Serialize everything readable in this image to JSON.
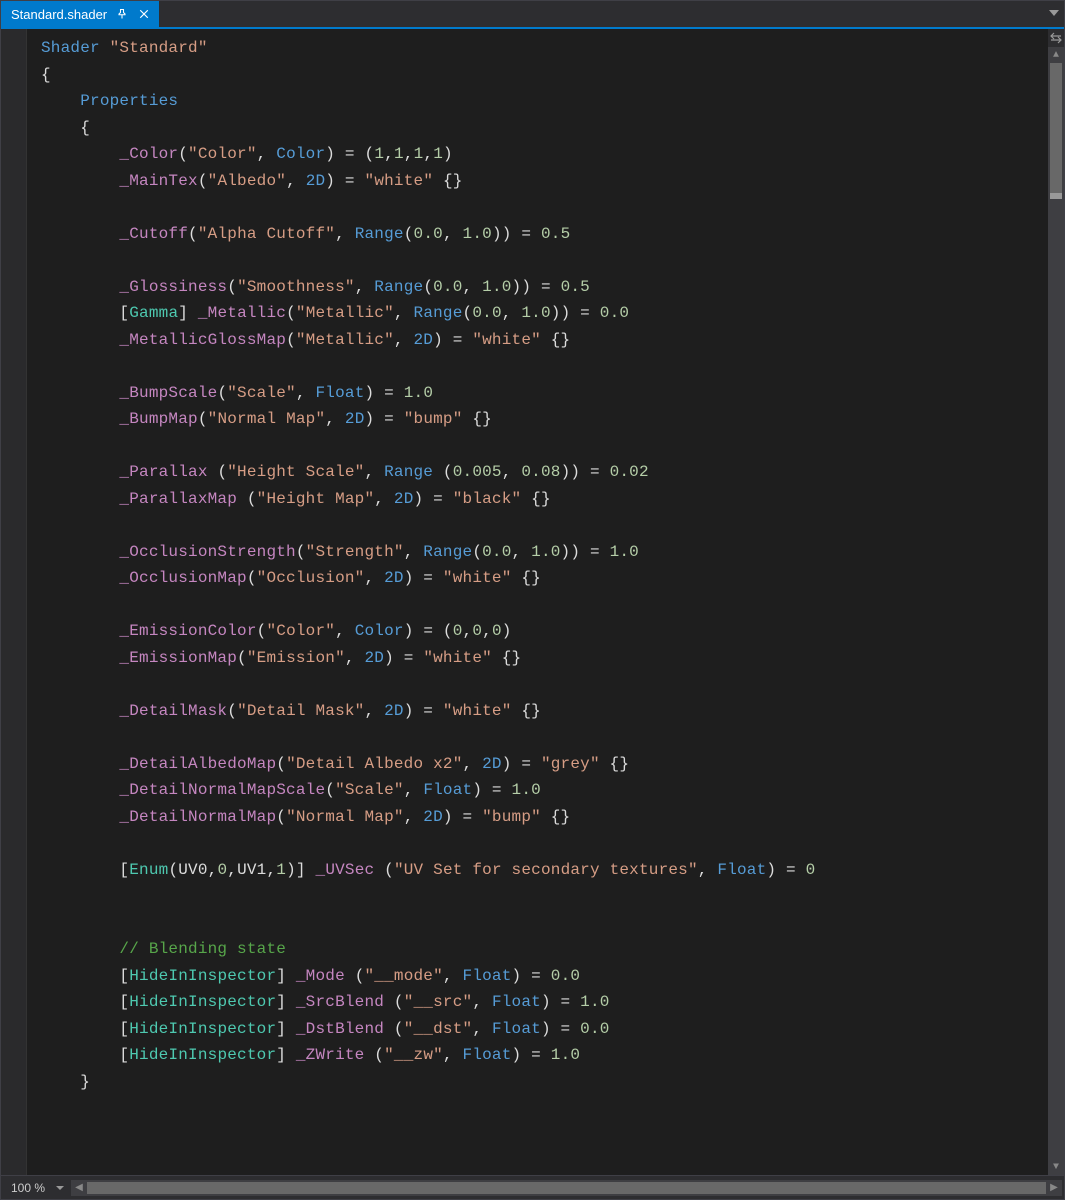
{
  "tab": {
    "title": "Standard.shader"
  },
  "zoom": {
    "value": "100 %"
  },
  "code": {
    "comment_blending": "// Blending state",
    "lines": [
      [
        [
          0,
          "kw",
          "Shader"
        ],
        [
          0,
          "plain",
          " "
        ],
        [
          0,
          "str",
          "\"Standard\""
        ]
      ],
      [
        [
          0,
          "plain",
          "{"
        ]
      ],
      [
        [
          1,
          "kw",
          "Properties"
        ]
      ],
      [
        [
          1,
          "plain",
          "{"
        ]
      ],
      [
        [
          2,
          "id",
          "_Color"
        ],
        [
          0,
          "paren",
          "("
        ],
        [
          0,
          "str",
          "\"Color\""
        ],
        [
          0,
          "paren",
          ", "
        ],
        [
          0,
          "type",
          "Color"
        ],
        [
          0,
          "paren",
          ") = ("
        ],
        [
          0,
          "num",
          "1"
        ],
        [
          0,
          "paren",
          ","
        ],
        [
          0,
          "num",
          "1"
        ],
        [
          0,
          "paren",
          ","
        ],
        [
          0,
          "num",
          "1"
        ],
        [
          0,
          "paren",
          ","
        ],
        [
          0,
          "num",
          "1"
        ],
        [
          0,
          "paren",
          ")"
        ]
      ],
      [
        [
          2,
          "id",
          "_MainTex"
        ],
        [
          0,
          "paren",
          "("
        ],
        [
          0,
          "str",
          "\"Albedo\""
        ],
        [
          0,
          "paren",
          ", "
        ],
        [
          0,
          "type",
          "2D"
        ],
        [
          0,
          "paren",
          ") = "
        ],
        [
          0,
          "str",
          "\"white\""
        ],
        [
          0,
          "paren",
          " {}"
        ]
      ],
      [],
      [
        [
          2,
          "id",
          "_Cutoff"
        ],
        [
          0,
          "paren",
          "("
        ],
        [
          0,
          "str",
          "\"Alpha Cutoff\""
        ],
        [
          0,
          "paren",
          ", "
        ],
        [
          0,
          "type",
          "Range"
        ],
        [
          0,
          "paren",
          "("
        ],
        [
          0,
          "num",
          "0.0"
        ],
        [
          0,
          "paren",
          ", "
        ],
        [
          0,
          "num",
          "1.0"
        ],
        [
          0,
          "paren",
          ")) = "
        ],
        [
          0,
          "num",
          "0.5"
        ]
      ],
      [],
      [
        [
          2,
          "id",
          "_Glossiness"
        ],
        [
          0,
          "paren",
          "("
        ],
        [
          0,
          "str",
          "\"Smoothness\""
        ],
        [
          0,
          "paren",
          ", "
        ],
        [
          0,
          "type",
          "Range"
        ],
        [
          0,
          "paren",
          "("
        ],
        [
          0,
          "num",
          "0.0"
        ],
        [
          0,
          "paren",
          ", "
        ],
        [
          0,
          "num",
          "1.0"
        ],
        [
          0,
          "paren",
          ")) = "
        ],
        [
          0,
          "num",
          "0.5"
        ]
      ],
      [
        [
          2,
          "paren",
          "["
        ],
        [
          0,
          "attr",
          "Gamma"
        ],
        [
          0,
          "paren",
          "] "
        ],
        [
          0,
          "id",
          "_Metallic"
        ],
        [
          0,
          "paren",
          "("
        ],
        [
          0,
          "str",
          "\"Metallic\""
        ],
        [
          0,
          "paren",
          ", "
        ],
        [
          0,
          "type",
          "Range"
        ],
        [
          0,
          "paren",
          "("
        ],
        [
          0,
          "num",
          "0.0"
        ],
        [
          0,
          "paren",
          ", "
        ],
        [
          0,
          "num",
          "1.0"
        ],
        [
          0,
          "paren",
          ")) = "
        ],
        [
          0,
          "num",
          "0.0"
        ]
      ],
      [
        [
          2,
          "id",
          "_MetallicGlossMap"
        ],
        [
          0,
          "paren",
          "("
        ],
        [
          0,
          "str",
          "\"Metallic\""
        ],
        [
          0,
          "paren",
          ", "
        ],
        [
          0,
          "type",
          "2D"
        ],
        [
          0,
          "paren",
          ") = "
        ],
        [
          0,
          "str",
          "\"white\""
        ],
        [
          0,
          "paren",
          " {}"
        ]
      ],
      [],
      [
        [
          2,
          "id",
          "_BumpScale"
        ],
        [
          0,
          "paren",
          "("
        ],
        [
          0,
          "str",
          "\"Scale\""
        ],
        [
          0,
          "paren",
          ", "
        ],
        [
          0,
          "type",
          "Float"
        ],
        [
          0,
          "paren",
          ") = "
        ],
        [
          0,
          "num",
          "1.0"
        ]
      ],
      [
        [
          2,
          "id",
          "_BumpMap"
        ],
        [
          0,
          "paren",
          "("
        ],
        [
          0,
          "str",
          "\"Normal Map\""
        ],
        [
          0,
          "paren",
          ", "
        ],
        [
          0,
          "type",
          "2D"
        ],
        [
          0,
          "paren",
          ") = "
        ],
        [
          0,
          "str",
          "\"bump\""
        ],
        [
          0,
          "paren",
          " {}"
        ]
      ],
      [],
      [
        [
          2,
          "id",
          "_Parallax"
        ],
        [
          0,
          "paren",
          " ("
        ],
        [
          0,
          "str",
          "\"Height Scale\""
        ],
        [
          0,
          "paren",
          ", "
        ],
        [
          0,
          "type",
          "Range"
        ],
        [
          0,
          "paren",
          " ("
        ],
        [
          0,
          "num",
          "0.005"
        ],
        [
          0,
          "paren",
          ", "
        ],
        [
          0,
          "num",
          "0.08"
        ],
        [
          0,
          "paren",
          ")) = "
        ],
        [
          0,
          "num",
          "0.02"
        ]
      ],
      [
        [
          2,
          "id",
          "_ParallaxMap"
        ],
        [
          0,
          "paren",
          " ("
        ],
        [
          0,
          "str",
          "\"Height Map\""
        ],
        [
          0,
          "paren",
          ", "
        ],
        [
          0,
          "type",
          "2D"
        ],
        [
          0,
          "paren",
          ") = "
        ],
        [
          0,
          "str",
          "\"black\""
        ],
        [
          0,
          "paren",
          " {}"
        ]
      ],
      [],
      [
        [
          2,
          "id",
          "_OcclusionStrength"
        ],
        [
          0,
          "paren",
          "("
        ],
        [
          0,
          "str",
          "\"Strength\""
        ],
        [
          0,
          "paren",
          ", "
        ],
        [
          0,
          "type",
          "Range"
        ],
        [
          0,
          "paren",
          "("
        ],
        [
          0,
          "num",
          "0.0"
        ],
        [
          0,
          "paren",
          ", "
        ],
        [
          0,
          "num",
          "1.0"
        ],
        [
          0,
          "paren",
          ")) = "
        ],
        [
          0,
          "num",
          "1.0"
        ]
      ],
      [
        [
          2,
          "id",
          "_OcclusionMap"
        ],
        [
          0,
          "paren",
          "("
        ],
        [
          0,
          "str",
          "\"Occlusion\""
        ],
        [
          0,
          "paren",
          ", "
        ],
        [
          0,
          "type",
          "2D"
        ],
        [
          0,
          "paren",
          ") = "
        ],
        [
          0,
          "str",
          "\"white\""
        ],
        [
          0,
          "paren",
          " {}"
        ]
      ],
      [],
      [
        [
          2,
          "id",
          "_EmissionColor"
        ],
        [
          0,
          "paren",
          "("
        ],
        [
          0,
          "str",
          "\"Color\""
        ],
        [
          0,
          "paren",
          ", "
        ],
        [
          0,
          "type",
          "Color"
        ],
        [
          0,
          "paren",
          ") = ("
        ],
        [
          0,
          "num",
          "0"
        ],
        [
          0,
          "paren",
          ","
        ],
        [
          0,
          "num",
          "0"
        ],
        [
          0,
          "paren",
          ","
        ],
        [
          0,
          "num",
          "0"
        ],
        [
          0,
          "paren",
          ")"
        ]
      ],
      [
        [
          2,
          "id",
          "_EmissionMap"
        ],
        [
          0,
          "paren",
          "("
        ],
        [
          0,
          "str",
          "\"Emission\""
        ],
        [
          0,
          "paren",
          ", "
        ],
        [
          0,
          "type",
          "2D"
        ],
        [
          0,
          "paren",
          ") = "
        ],
        [
          0,
          "str",
          "\"white\""
        ],
        [
          0,
          "paren",
          " {}"
        ]
      ],
      [],
      [
        [
          2,
          "id",
          "_DetailMask"
        ],
        [
          0,
          "paren",
          "("
        ],
        [
          0,
          "str",
          "\"Detail Mask\""
        ],
        [
          0,
          "paren",
          ", "
        ],
        [
          0,
          "type",
          "2D"
        ],
        [
          0,
          "paren",
          ") = "
        ],
        [
          0,
          "str",
          "\"white\""
        ],
        [
          0,
          "paren",
          " {}"
        ]
      ],
      [],
      [
        [
          2,
          "id",
          "_DetailAlbedoMap"
        ],
        [
          0,
          "paren",
          "("
        ],
        [
          0,
          "str",
          "\"Detail Albedo x2\""
        ],
        [
          0,
          "paren",
          ", "
        ],
        [
          0,
          "type",
          "2D"
        ],
        [
          0,
          "paren",
          ") = "
        ],
        [
          0,
          "str",
          "\"grey\""
        ],
        [
          0,
          "paren",
          " {}"
        ]
      ],
      [
        [
          2,
          "id",
          "_DetailNormalMapScale"
        ],
        [
          0,
          "paren",
          "("
        ],
        [
          0,
          "str",
          "\"Scale\""
        ],
        [
          0,
          "paren",
          ", "
        ],
        [
          0,
          "type",
          "Float"
        ],
        [
          0,
          "paren",
          ") = "
        ],
        [
          0,
          "num",
          "1.0"
        ]
      ],
      [
        [
          2,
          "id",
          "_DetailNormalMap"
        ],
        [
          0,
          "paren",
          "("
        ],
        [
          0,
          "str",
          "\"Normal Map\""
        ],
        [
          0,
          "paren",
          ", "
        ],
        [
          0,
          "type",
          "2D"
        ],
        [
          0,
          "paren",
          ") = "
        ],
        [
          0,
          "str",
          "\"bump\""
        ],
        [
          0,
          "paren",
          " {}"
        ]
      ],
      [],
      [
        [
          2,
          "paren",
          "["
        ],
        [
          0,
          "attr",
          "Enum"
        ],
        [
          0,
          "paren",
          "(UV0,"
        ],
        [
          0,
          "num",
          "0"
        ],
        [
          0,
          "paren",
          ",UV1,"
        ],
        [
          0,
          "num",
          "1"
        ],
        [
          0,
          "paren",
          ")] "
        ],
        [
          0,
          "id",
          "_UVSec"
        ],
        [
          0,
          "paren",
          " ("
        ],
        [
          0,
          "str",
          "\"UV Set for secondary textures\""
        ],
        [
          0,
          "paren",
          ", "
        ],
        [
          0,
          "type",
          "Float"
        ],
        [
          0,
          "paren",
          ") = "
        ],
        [
          0,
          "num",
          "0"
        ]
      ],
      [],
      [],
      [
        [
          2,
          "comm",
          "// Blending state"
        ]
      ],
      [
        [
          2,
          "paren",
          "["
        ],
        [
          0,
          "attr",
          "HideInInspector"
        ],
        [
          0,
          "paren",
          "] "
        ],
        [
          0,
          "id",
          "_Mode"
        ],
        [
          0,
          "paren",
          " ("
        ],
        [
          0,
          "str",
          "\"__mode\""
        ],
        [
          0,
          "paren",
          ", "
        ],
        [
          0,
          "type",
          "Float"
        ],
        [
          0,
          "paren",
          ") = "
        ],
        [
          0,
          "num",
          "0.0"
        ]
      ],
      [
        [
          2,
          "paren",
          "["
        ],
        [
          0,
          "attr",
          "HideInInspector"
        ],
        [
          0,
          "paren",
          "] "
        ],
        [
          0,
          "id",
          "_SrcBlend"
        ],
        [
          0,
          "paren",
          " ("
        ],
        [
          0,
          "str",
          "\"__src\""
        ],
        [
          0,
          "paren",
          ", "
        ],
        [
          0,
          "type",
          "Float"
        ],
        [
          0,
          "paren",
          ") = "
        ],
        [
          0,
          "num",
          "1.0"
        ]
      ],
      [
        [
          2,
          "paren",
          "["
        ],
        [
          0,
          "attr",
          "HideInInspector"
        ],
        [
          0,
          "paren",
          "] "
        ],
        [
          0,
          "id",
          "_DstBlend"
        ],
        [
          0,
          "paren",
          " ("
        ],
        [
          0,
          "str",
          "\"__dst\""
        ],
        [
          0,
          "paren",
          ", "
        ],
        [
          0,
          "type",
          "Float"
        ],
        [
          0,
          "paren",
          ") = "
        ],
        [
          0,
          "num",
          "0.0"
        ]
      ],
      [
        [
          2,
          "paren",
          "["
        ],
        [
          0,
          "attr",
          "HideInInspector"
        ],
        [
          0,
          "paren",
          "] "
        ],
        [
          0,
          "id",
          "_ZWrite"
        ],
        [
          0,
          "paren",
          " ("
        ],
        [
          0,
          "str",
          "\"__zw\""
        ],
        [
          0,
          "paren",
          ", "
        ],
        [
          0,
          "type",
          "Float"
        ],
        [
          0,
          "paren",
          ") = "
        ],
        [
          0,
          "num",
          "1.0"
        ]
      ],
      [
        [
          1,
          "plain",
          "}"
        ]
      ]
    ]
  }
}
